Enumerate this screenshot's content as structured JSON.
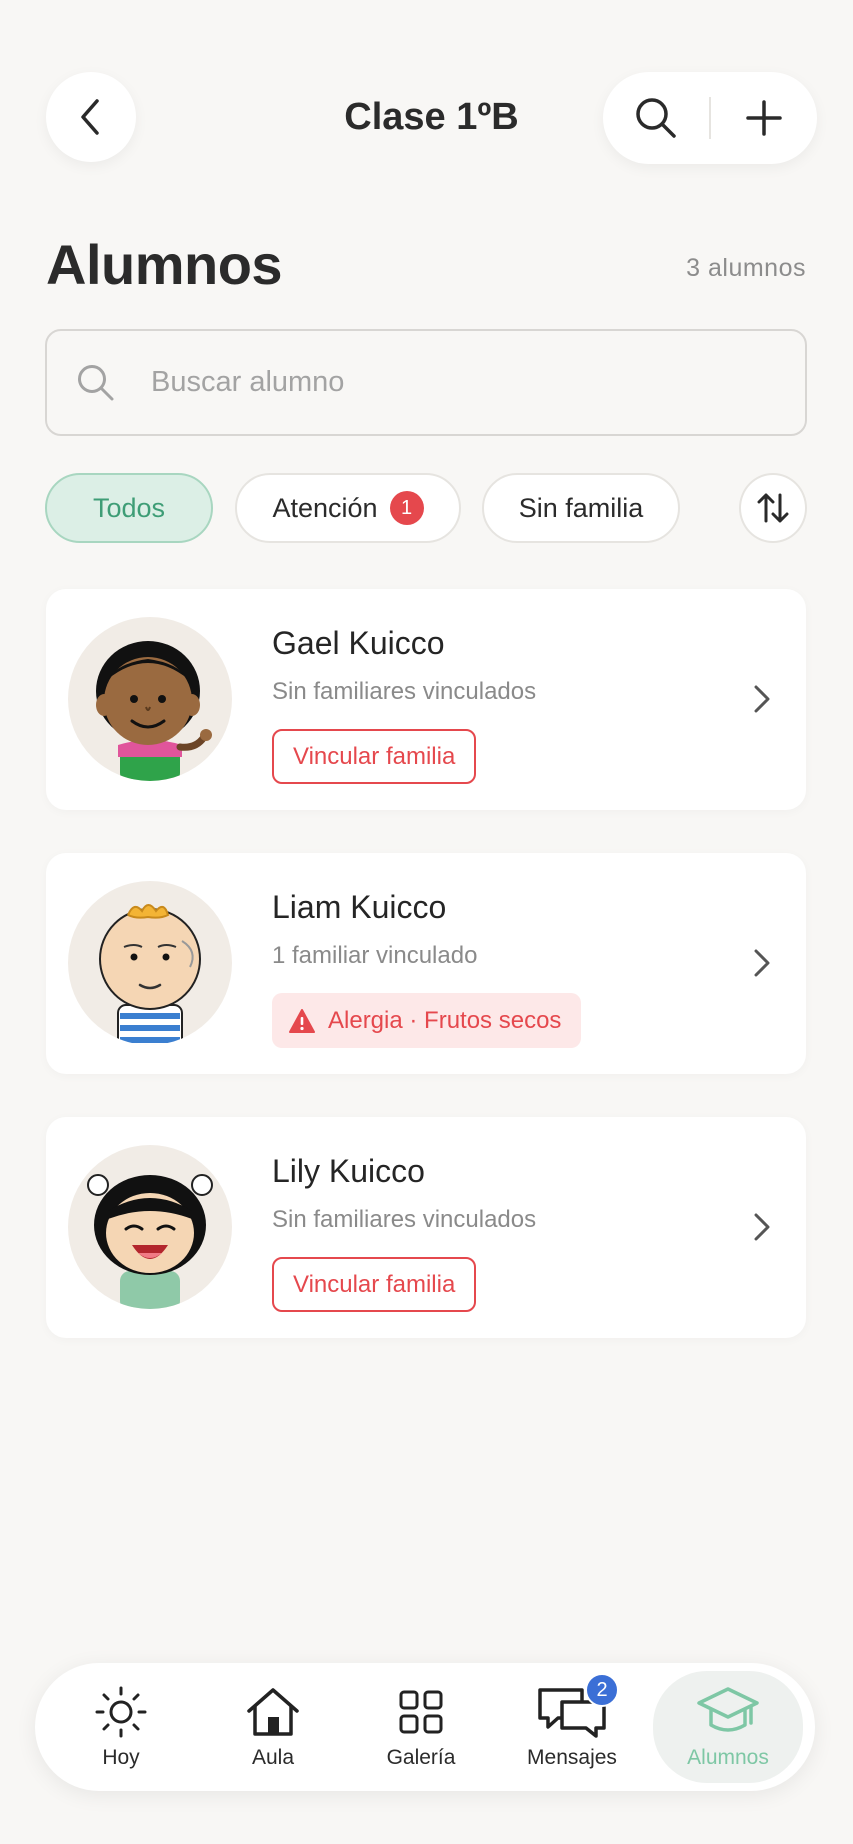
{
  "header": {
    "title": "Clase 1ºB",
    "back_icon": "chevron-left-icon",
    "search_icon": "search-icon",
    "add_icon": "plus-icon"
  },
  "section": {
    "title": "Alumnos",
    "count": "3 alumnos"
  },
  "search": {
    "placeholder": "Buscar alumno",
    "value": ""
  },
  "filters": {
    "chips": [
      {
        "label": "Todos",
        "active": true
      },
      {
        "label": "Atención",
        "badge": "1",
        "active": false
      },
      {
        "label": "Sin familia",
        "active": false
      }
    ],
    "sort_icon": "sort-arrows-icon"
  },
  "students": [
    {
      "name": "Gael Kuicco",
      "subtitle": "Sin familiares vinculados",
      "tag": "Vincular familia",
      "tag_type": "outline"
    },
    {
      "name": "Liam Kuicco",
      "subtitle": "1 familiar vinculado",
      "tag": "Alergia · Frutos secos",
      "tag_type": "alert"
    },
    {
      "name": "Lily Kuicco",
      "subtitle": "Sin familiares vinculados",
      "tag": "Vincular familia",
      "tag_type": "outline"
    }
  ],
  "nav": {
    "items": [
      {
        "label": "Hoy",
        "icon": "sun-icon"
      },
      {
        "label": "Aula",
        "icon": "house-icon"
      },
      {
        "label": "Galería",
        "icon": "grid-icon"
      },
      {
        "label": "Mensajes",
        "icon": "chat-bubbles-icon",
        "badge": "2"
      },
      {
        "label": "Alumnos",
        "icon": "graduation-cap-icon",
        "active": true
      }
    ]
  },
  "colors": {
    "accent_green": "#3e9d76",
    "alert_red": "#e5484d",
    "badge_blue": "#3b6fd6",
    "background": "#f8f7f5"
  }
}
